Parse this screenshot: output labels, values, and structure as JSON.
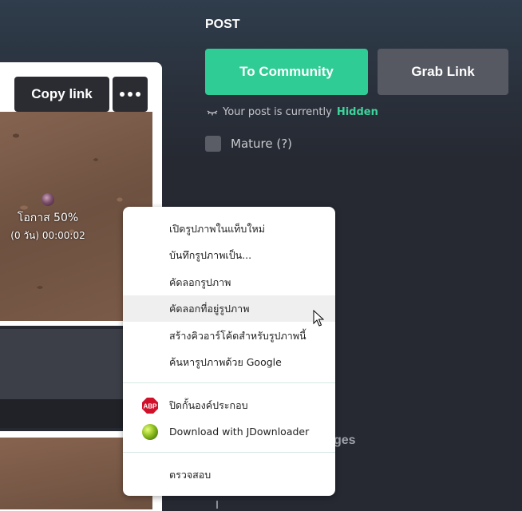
{
  "left_panel": {
    "copy_link_label": "Copy link",
    "more_icon": "ellipsis-icon",
    "image": {
      "chance_label": "โอกาส 50%",
      "timer_label": "(0 วัน) 00:00:02"
    }
  },
  "post": {
    "title": "POST",
    "to_community_label": "To Community",
    "grab_link_label": "Grab Link",
    "status_prefix": "Your post is currently",
    "status_value": "Hidden",
    "mature_label": "Mature (?)",
    "partial_text": "ges"
  },
  "context_menu": {
    "items": [
      {
        "label": "เปิดรูปภาพในแท็บใหม่"
      },
      {
        "label": "บันทึกรูปภาพเป็น..."
      },
      {
        "label": "คัดลอกรูปภาพ"
      },
      {
        "label": "คัดลอกที่อยู่รูปภาพ",
        "highlighted": true
      },
      {
        "label": "สร้างคิวอาร์โค้ดสำหรับรูปภาพนี้"
      },
      {
        "label": "ค้นหารูปภาพด้วย Google"
      }
    ],
    "extension_items": [
      {
        "label": "ปิดกั้นองค์ประกอบ",
        "icon": "adblock-plus-icon"
      },
      {
        "label": "Download with JDownloader",
        "icon": "jdownloader-icon"
      }
    ],
    "inspect_label": "ตรวจสอบ"
  },
  "colors": {
    "accent_green": "#2fcc95",
    "hidden_green": "#3dd49c",
    "background": "#262932"
  }
}
